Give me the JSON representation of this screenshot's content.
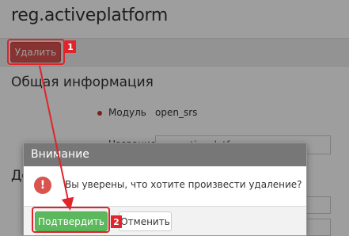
{
  "page": {
    "title": "reg.activeplatform",
    "delete_label": "Удалить",
    "section_general": "Общая информация",
    "module_label": "Модуль",
    "module_value": "open_srs",
    "name_label": "Название",
    "name_value": "reg.activeplatform",
    "section_second": "До"
  },
  "dialog": {
    "title": "Внимание",
    "icon": "exclamation-icon",
    "message": "Вы уверены, что хотите произвести удаление?",
    "confirm_label": "Подтвердить",
    "cancel_label": "Отменить"
  },
  "annotations": {
    "step1": "1",
    "step2": "2",
    "color": "#e0242b"
  },
  "colors": {
    "danger": "#d9534f",
    "success": "#5cb85c",
    "dialog_header": "#777777"
  }
}
